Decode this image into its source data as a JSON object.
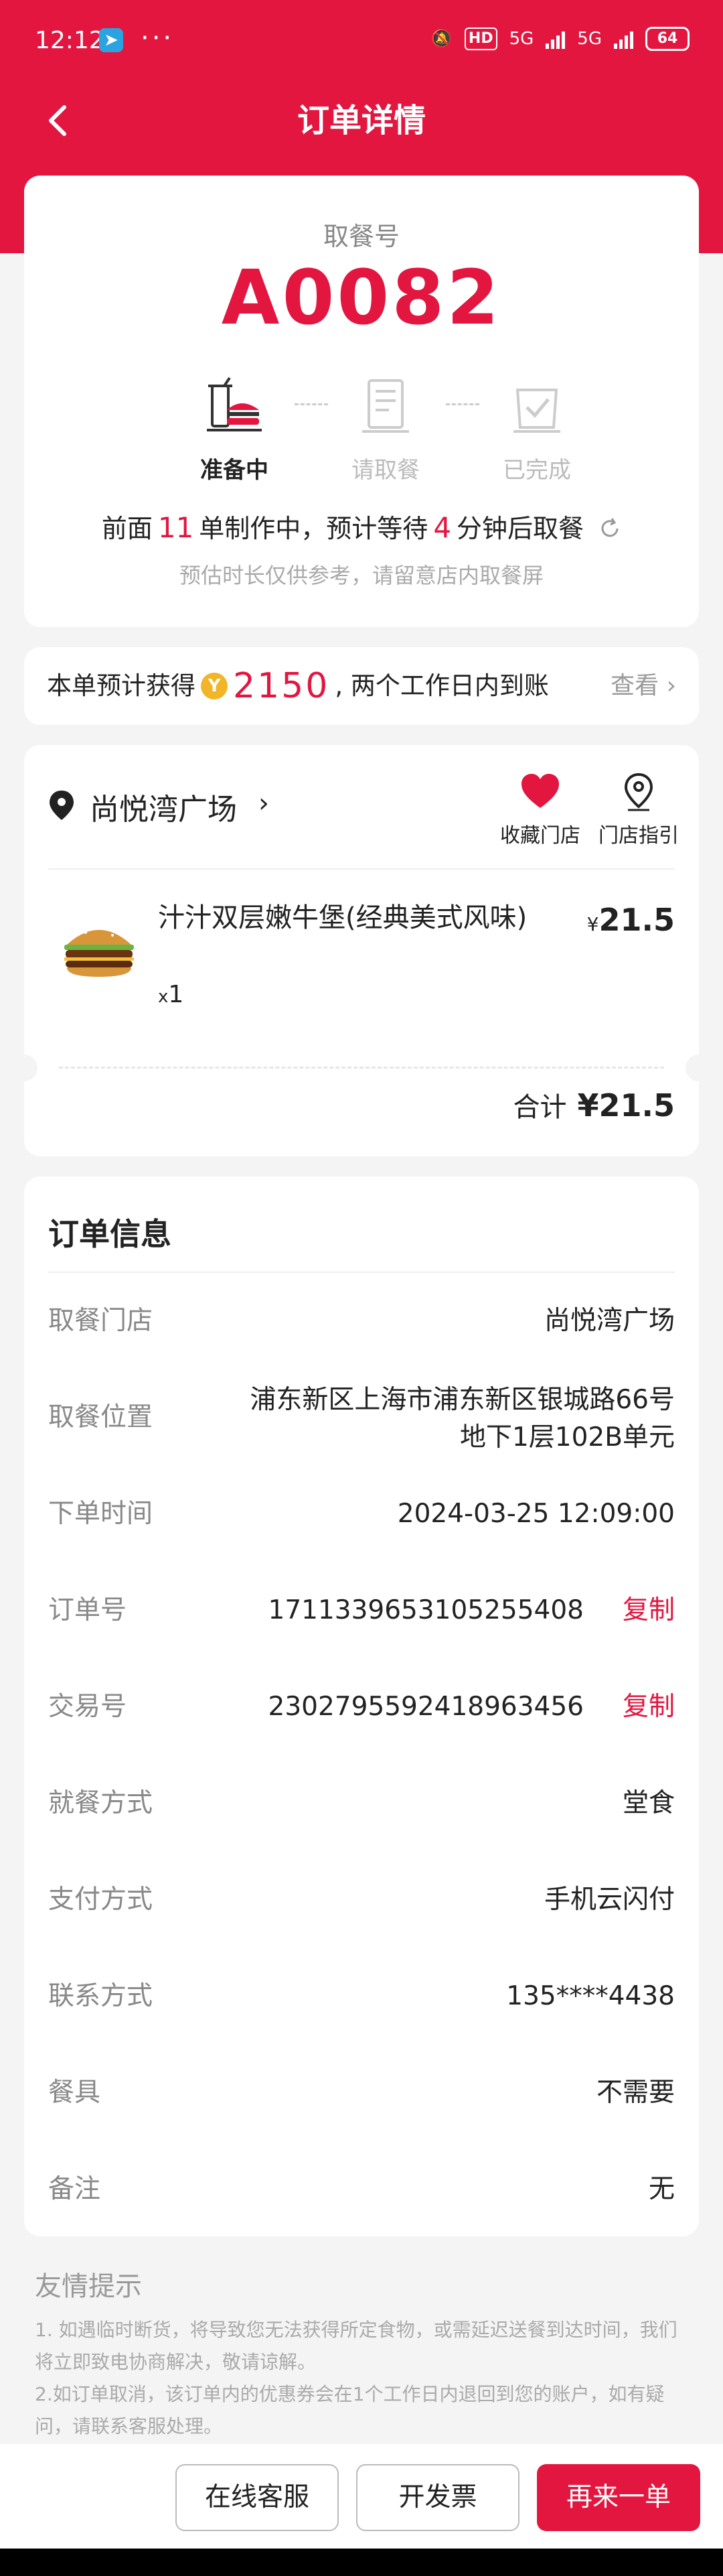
{
  "status": {
    "time": "12:12",
    "dots": "···",
    "hd": "HD",
    "net1": "5G",
    "net2": "5G",
    "battery": "64"
  },
  "nav": {
    "title": "订单详情"
  },
  "pickup": {
    "label": "取餐号",
    "number": "A0082",
    "steps": [
      "准备中",
      "请取餐",
      "已完成"
    ],
    "queue_pre": "前面",
    "queue_count": "11",
    "queue_mid": "单制作中，预计等待",
    "queue_wait": "4",
    "queue_post": "分钟后取餐",
    "hint": "预估时长仅供参考，请留意店内取餐屏"
  },
  "points": {
    "pre": "本单预计获得",
    "coin": "Y",
    "value": "2150",
    "post": ", 两个工作日内到账",
    "link": "查看 ›"
  },
  "store": {
    "name": "尚悦湾广场",
    "fav_label": "收藏门店",
    "guide_label": "门店指引",
    "item_name": "汁汁双层嫩牛堡(经典美式风味)",
    "item_qty_prefix": "x",
    "item_qty": "1",
    "item_price_symbol": "¥",
    "item_price": "21.5",
    "total_label": "合计",
    "total_value": "¥21.5"
  },
  "info": {
    "title": "订单信息",
    "rows": [
      {
        "k": "取餐门店",
        "v": "尚悦湾广场"
      },
      {
        "k": "取餐位置",
        "v": "浦东新区上海市浦东新区银城路66号地下1层102B单元"
      },
      {
        "k": "下单时间",
        "v": "2024-03-25 12:09:00"
      },
      {
        "k": "订单号",
        "v": "1711339653105255408",
        "copy": "复制"
      },
      {
        "k": "交易号",
        "v": "2302795592418963456",
        "copy": "复制"
      },
      {
        "k": "就餐方式",
        "v": "堂食"
      },
      {
        "k": "支付方式",
        "v": "手机云闪付"
      },
      {
        "k": "联系方式",
        "v": "135****4438"
      },
      {
        "k": "餐具",
        "v": "不需要"
      },
      {
        "k": "备注",
        "v": "无"
      }
    ]
  },
  "tips": {
    "title": "友情提示",
    "line1": "1. 如遇临时断货，将导致您无法获得所定食物，或需延迟送餐到达时间，我们将立即致电协商解决，敬请谅解。",
    "line2": "2.如订单取消，该订单内的优惠券会在1个工作日内退回到您的账户，如有疑问，请联系客服处理。"
  },
  "actions": {
    "service": "在线客服",
    "invoice": "开发票",
    "reorder": "再来一单"
  },
  "colors": {
    "brand": "#e2163f"
  }
}
